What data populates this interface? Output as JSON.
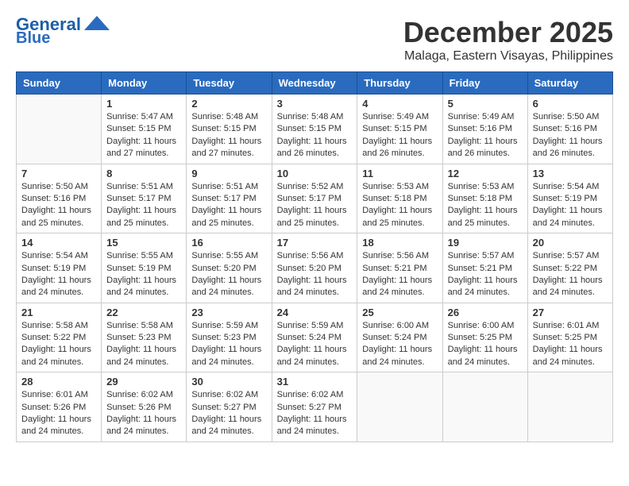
{
  "header": {
    "logo_line1": "General",
    "logo_line2": "Blue",
    "title": "December 2025",
    "subtitle": "Malaga, Eastern Visayas, Philippines"
  },
  "calendar": {
    "weekdays": [
      "Sunday",
      "Monday",
      "Tuesday",
      "Wednesday",
      "Thursday",
      "Friday",
      "Saturday"
    ],
    "weeks": [
      [
        {
          "day": "",
          "info": ""
        },
        {
          "day": "1",
          "info": "Sunrise: 5:47 AM\nSunset: 5:15 PM\nDaylight: 11 hours\nand 27 minutes."
        },
        {
          "day": "2",
          "info": "Sunrise: 5:48 AM\nSunset: 5:15 PM\nDaylight: 11 hours\nand 27 minutes."
        },
        {
          "day": "3",
          "info": "Sunrise: 5:48 AM\nSunset: 5:15 PM\nDaylight: 11 hours\nand 26 minutes."
        },
        {
          "day": "4",
          "info": "Sunrise: 5:49 AM\nSunset: 5:15 PM\nDaylight: 11 hours\nand 26 minutes."
        },
        {
          "day": "5",
          "info": "Sunrise: 5:49 AM\nSunset: 5:16 PM\nDaylight: 11 hours\nand 26 minutes."
        },
        {
          "day": "6",
          "info": "Sunrise: 5:50 AM\nSunset: 5:16 PM\nDaylight: 11 hours\nand 26 minutes."
        }
      ],
      [
        {
          "day": "7",
          "info": "Sunrise: 5:50 AM\nSunset: 5:16 PM\nDaylight: 11 hours\nand 25 minutes."
        },
        {
          "day": "8",
          "info": "Sunrise: 5:51 AM\nSunset: 5:17 PM\nDaylight: 11 hours\nand 25 minutes."
        },
        {
          "day": "9",
          "info": "Sunrise: 5:51 AM\nSunset: 5:17 PM\nDaylight: 11 hours\nand 25 minutes."
        },
        {
          "day": "10",
          "info": "Sunrise: 5:52 AM\nSunset: 5:17 PM\nDaylight: 11 hours\nand 25 minutes."
        },
        {
          "day": "11",
          "info": "Sunrise: 5:53 AM\nSunset: 5:18 PM\nDaylight: 11 hours\nand 25 minutes."
        },
        {
          "day": "12",
          "info": "Sunrise: 5:53 AM\nSunset: 5:18 PM\nDaylight: 11 hours\nand 25 minutes."
        },
        {
          "day": "13",
          "info": "Sunrise: 5:54 AM\nSunset: 5:19 PM\nDaylight: 11 hours\nand 24 minutes."
        }
      ],
      [
        {
          "day": "14",
          "info": "Sunrise: 5:54 AM\nSunset: 5:19 PM\nDaylight: 11 hours\nand 24 minutes."
        },
        {
          "day": "15",
          "info": "Sunrise: 5:55 AM\nSunset: 5:19 PM\nDaylight: 11 hours\nand 24 minutes."
        },
        {
          "day": "16",
          "info": "Sunrise: 5:55 AM\nSunset: 5:20 PM\nDaylight: 11 hours\nand 24 minutes."
        },
        {
          "day": "17",
          "info": "Sunrise: 5:56 AM\nSunset: 5:20 PM\nDaylight: 11 hours\nand 24 minutes."
        },
        {
          "day": "18",
          "info": "Sunrise: 5:56 AM\nSunset: 5:21 PM\nDaylight: 11 hours\nand 24 minutes."
        },
        {
          "day": "19",
          "info": "Sunrise: 5:57 AM\nSunset: 5:21 PM\nDaylight: 11 hours\nand 24 minutes."
        },
        {
          "day": "20",
          "info": "Sunrise: 5:57 AM\nSunset: 5:22 PM\nDaylight: 11 hours\nand 24 minutes."
        }
      ],
      [
        {
          "day": "21",
          "info": "Sunrise: 5:58 AM\nSunset: 5:22 PM\nDaylight: 11 hours\nand 24 minutes."
        },
        {
          "day": "22",
          "info": "Sunrise: 5:58 AM\nSunset: 5:23 PM\nDaylight: 11 hours\nand 24 minutes."
        },
        {
          "day": "23",
          "info": "Sunrise: 5:59 AM\nSunset: 5:23 PM\nDaylight: 11 hours\nand 24 minutes."
        },
        {
          "day": "24",
          "info": "Sunrise: 5:59 AM\nSunset: 5:24 PM\nDaylight: 11 hours\nand 24 minutes."
        },
        {
          "day": "25",
          "info": "Sunrise: 6:00 AM\nSunset: 5:24 PM\nDaylight: 11 hours\nand 24 minutes."
        },
        {
          "day": "26",
          "info": "Sunrise: 6:00 AM\nSunset: 5:25 PM\nDaylight: 11 hours\nand 24 minutes."
        },
        {
          "day": "27",
          "info": "Sunrise: 6:01 AM\nSunset: 5:25 PM\nDaylight: 11 hours\nand 24 minutes."
        }
      ],
      [
        {
          "day": "28",
          "info": "Sunrise: 6:01 AM\nSunset: 5:26 PM\nDaylight: 11 hours\nand 24 minutes."
        },
        {
          "day": "29",
          "info": "Sunrise: 6:02 AM\nSunset: 5:26 PM\nDaylight: 11 hours\nand 24 minutes."
        },
        {
          "day": "30",
          "info": "Sunrise: 6:02 AM\nSunset: 5:27 PM\nDaylight: 11 hours\nand 24 minutes."
        },
        {
          "day": "31",
          "info": "Sunrise: 6:02 AM\nSunset: 5:27 PM\nDaylight: 11 hours\nand 24 minutes."
        },
        {
          "day": "",
          "info": ""
        },
        {
          "day": "",
          "info": ""
        },
        {
          "day": "",
          "info": ""
        }
      ]
    ]
  }
}
